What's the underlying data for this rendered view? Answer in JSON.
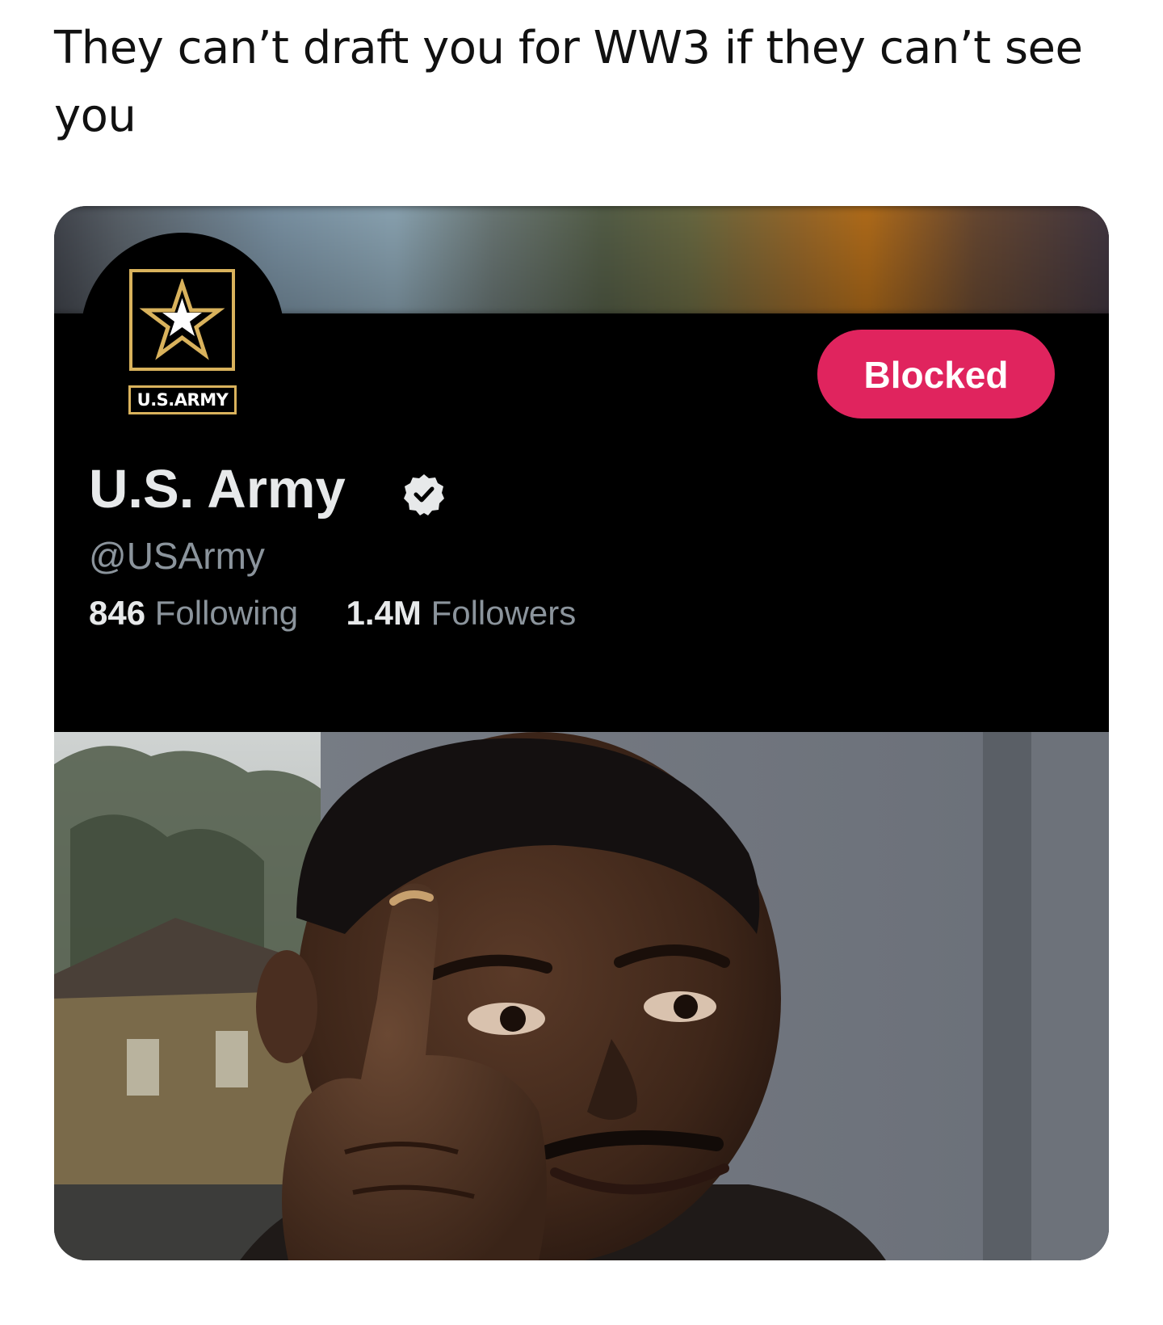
{
  "post": {
    "caption": "They can’t draft you for WW3 if they can’t see you"
  },
  "profile": {
    "logo_text": "U.S.ARMY",
    "display_name": "U.S. Army",
    "handle": "@USArmy",
    "verified": true,
    "follow_state_label": "Blocked",
    "following_count": "846",
    "following_label": "Following",
    "followers_count": "1.4M",
    "followers_label": "Followers"
  },
  "colors": {
    "blocked_button": "#e0245e",
    "logo_gold": "#d9b25c",
    "profile_background": "#000000"
  },
  "icons": {
    "verified": "verified-badge-icon",
    "logo": "army-star-logo"
  }
}
